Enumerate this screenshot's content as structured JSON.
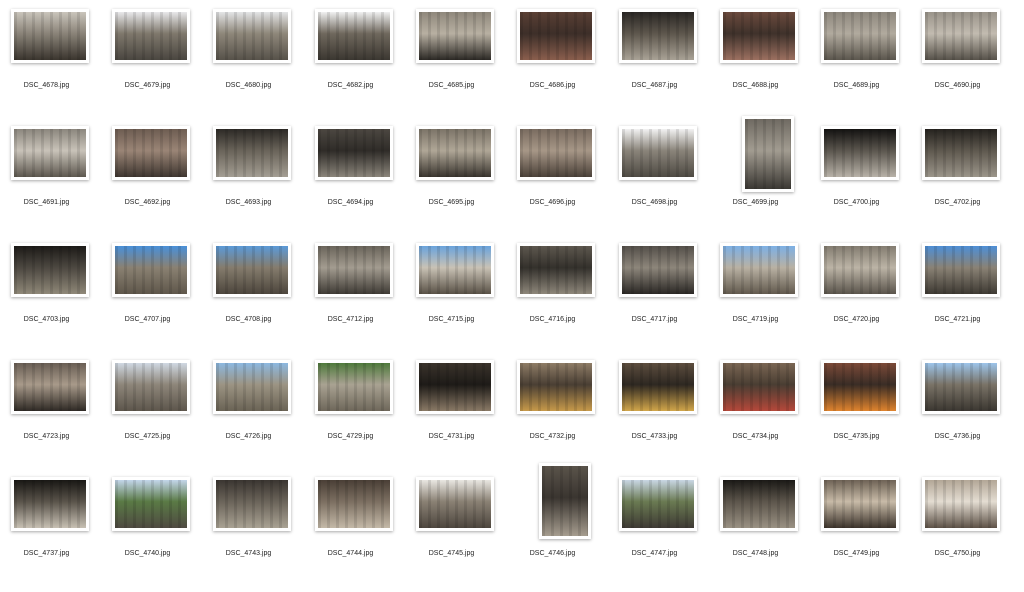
{
  "files": [
    {
      "name": "DSC_4678.jpg",
      "orientation": "landscape",
      "colors": [
        "#c9c4bb",
        "#3a352e",
        "#8a8378"
      ]
    },
    {
      "name": "DSC_4679.jpg",
      "orientation": "landscape",
      "colors": [
        "#e8e8ea",
        "#4a4640",
        "#7f786c"
      ]
    },
    {
      "name": "DSC_4680.jpg",
      "orientation": "landscape",
      "colors": [
        "#e3e4e6",
        "#57524a",
        "#8e877a"
      ]
    },
    {
      "name": "DSC_4682.jpg",
      "orientation": "landscape",
      "colors": [
        "#f0f0f0",
        "#3b3731",
        "#6f685d"
      ]
    },
    {
      "name": "DSC_4685.jpg",
      "orientation": "landscape",
      "colors": [
        "#8f887c",
        "#2c2925",
        "#b8b0a2"
      ]
    },
    {
      "name": "DSC_4686.jpg",
      "orientation": "landscape",
      "colors": [
        "#5a3f34",
        "#8a5e4d",
        "#3d2f29"
      ]
    },
    {
      "name": "DSC_4687.jpg",
      "orientation": "landscape",
      "colors": [
        "#2a2724",
        "#a9a296",
        "#5e574d"
      ]
    },
    {
      "name": "DSC_4688.jpg",
      "orientation": "landscape",
      "colors": [
        "#6b4a3d",
        "#9c7060",
        "#3f322b"
      ]
    },
    {
      "name": "DSC_4689.jpg",
      "orientation": "landscape",
      "colors": [
        "#8e887e",
        "#5b564d",
        "#b1aa9e"
      ]
    },
    {
      "name": "DSC_4690.jpg",
      "orientation": "landscape",
      "colors": [
        "#9a948a",
        "#57524a",
        "#c2bbb0"
      ]
    },
    {
      "name": "DSC_4691.jpg",
      "orientation": "landscape",
      "colors": [
        "#8c877e",
        "#5d584f",
        "#c9c3b9"
      ]
    },
    {
      "name": "DSC_4692.jpg",
      "orientation": "landscape",
      "colors": [
        "#6e5d52",
        "#3f3630",
        "#9a8576"
      ]
    },
    {
      "name": "DSC_4693.jpg",
      "orientation": "landscape",
      "colors": [
        "#2d2a26",
        "#a49e93",
        "#6a645a"
      ]
    },
    {
      "name": "DSC_4694.jpg",
      "orientation": "landscape",
      "colors": [
        "#4c4741",
        "#8b857b",
        "#2f2c28"
      ]
    },
    {
      "name": "DSC_4695.jpg",
      "orientation": "landscape",
      "colors": [
        "#7c7468",
        "#3a352f",
        "#b0a797"
      ]
    },
    {
      "name": "DSC_4696.jpg",
      "orientation": "landscape",
      "colors": [
        "#7a6c60",
        "#4b4139",
        "#a79787"
      ]
    },
    {
      "name": "DSC_4698.jpg",
      "orientation": "landscape",
      "colors": [
        "#f2f2f2",
        "#4e4a43",
        "#8a847a"
      ]
    },
    {
      "name": "DSC_4699.jpg",
      "orientation": "portrait",
      "colors": [
        "#6f6a62",
        "#3b3833",
        "#a29c91"
      ]
    },
    {
      "name": "DSC_4700.jpg",
      "orientation": "landscape",
      "colors": [
        "#141312",
        "#b8b2a8",
        "#5c574f"
      ]
    },
    {
      "name": "DSC_4702.jpg",
      "orientation": "landscape",
      "colors": [
        "#26231f",
        "#9b958a",
        "#5f594f"
      ]
    },
    {
      "name": "DSC_4703.jpg",
      "orientation": "landscape",
      "colors": [
        "#1d1b18",
        "#8f8878",
        "#4d4841"
      ]
    },
    {
      "name": "DSC_4707.jpg",
      "orientation": "landscape",
      "colors": [
        "#4a90d9",
        "#5f574b",
        "#8a8172"
      ]
    },
    {
      "name": "DSC_4708.jpg",
      "orientation": "landscape",
      "colors": [
        "#5b9ad8",
        "#4d463d",
        "#857c6d"
      ]
    },
    {
      "name": "DSC_4712.jpg",
      "orientation": "landscape",
      "colors": [
        "#6b655b",
        "#3f3b35",
        "#a39c90"
      ]
    },
    {
      "name": "DSC_4715.jpg",
      "orientation": "landscape",
      "colors": [
        "#6aa3dc",
        "#5a5247",
        "#c9c2b5"
      ]
    },
    {
      "name": "DSC_4716.jpg",
      "orientation": "landscape",
      "colors": [
        "#5d574e",
        "#8e877b",
        "#34312c"
      ]
    },
    {
      "name": "DSC_4717.jpg",
      "orientation": "landscape",
      "colors": [
        "#55504a",
        "#2b2825",
        "#8d867b"
      ]
    },
    {
      "name": "DSC_4719.jpg",
      "orientation": "landscape",
      "colors": [
        "#7db0e4",
        "#625a4e",
        "#b9b1a3"
      ]
    },
    {
      "name": "DSC_4720.jpg",
      "orientation": "landscape",
      "colors": [
        "#847d71",
        "#5b554c",
        "#bcb4a6"
      ]
    },
    {
      "name": "DSC_4721.jpg",
      "orientation": "landscape",
      "colors": [
        "#4e8fd6",
        "#3e3a33",
        "#8a8275"
      ]
    },
    {
      "name": "DSC_4723.jpg",
      "orientation": "landscape",
      "colors": [
        "#6a5f55",
        "#2f2a25",
        "#a89a8a"
      ]
    },
    {
      "name": "DSC_4725.jpg",
      "orientation": "landscape",
      "colors": [
        "#cfd8e2",
        "#5d564c",
        "#8e867a"
      ]
    },
    {
      "name": "DSC_4726.jpg",
      "orientation": "landscape",
      "colors": [
        "#8cb8e0",
        "#6a6355",
        "#9c9483"
      ]
    },
    {
      "name": "DSC_4729.jpg",
      "orientation": "landscape",
      "colors": [
        "#4f7a3c",
        "#6e675a",
        "#a9a292"
      ]
    },
    {
      "name": "DSC_4731.jpg",
      "orientation": "landscape",
      "colors": [
        "#3a332b",
        "#8a7a66",
        "#1e1b18"
      ]
    },
    {
      "name": "DSC_4732.jpg",
      "orientation": "landscape",
      "colors": [
        "#8e7c66",
        "#c79a4a",
        "#4a3f34"
      ]
    },
    {
      "name": "DSC_4733.jpg",
      "orientation": "landscape",
      "colors": [
        "#5c4d3e",
        "#d2a64a",
        "#2e2822"
      ]
    },
    {
      "name": "DSC_4734.jpg",
      "orientation": "landscape",
      "colors": [
        "#7a6653",
        "#b5483a",
        "#4a3e33"
      ]
    },
    {
      "name": "DSC_4735.jpg",
      "orientation": "landscape",
      "colors": [
        "#7b4a38",
        "#e0842e",
        "#3a2d26"
      ]
    },
    {
      "name": "DSC_4736.jpg",
      "orientation": "landscape",
      "colors": [
        "#9cc4ea",
        "#3b3731",
        "#7a7367"
      ]
    },
    {
      "name": "DSC_4737.jpg",
      "orientation": "landscape",
      "colors": [
        "#1a1815",
        "#c7c0b3",
        "#5a544b"
      ]
    },
    {
      "name": "DSC_4740.jpg",
      "orientation": "landscape",
      "colors": [
        "#c3d6ea",
        "#4f4a42",
        "#5a7a45"
      ]
    },
    {
      "name": "DSC_4743.jpg",
      "orientation": "landscape",
      "colors": [
        "#3b3631",
        "#a9a293",
        "#6b645a"
      ]
    },
    {
      "name": "DSC_4744.jpg",
      "orientation": "landscape",
      "colors": [
        "#4a3f36",
        "#c4b9a8",
        "#7c6f61"
      ]
    },
    {
      "name": "DSC_4745.jpg",
      "orientation": "landscape",
      "colors": [
        "#e9e7e2",
        "#4d463e",
        "#8a8174"
      ]
    },
    {
      "name": "DSC_4746.jpg",
      "orientation": "portrait",
      "colors": [
        "#5a534a",
        "#a69d8f",
        "#3a3530"
      ]
    },
    {
      "name": "DSC_4747.jpg",
      "orientation": "landscape",
      "colors": [
        "#c9d7e4",
        "#3e3a34",
        "#6a7a52"
      ]
    },
    {
      "name": "DSC_4748.jpg",
      "orientation": "landscape",
      "colors": [
        "#1c1a17",
        "#9a9183",
        "#5d564c"
      ]
    },
    {
      "name": "DSC_4749.jpg",
      "orientation": "landscape",
      "colors": [
        "#6f6356",
        "#3e352d",
        "#c8bba8"
      ]
    },
    {
      "name": "DSC_4750.jpg",
      "orientation": "landscape",
      "colors": [
        "#b3a797",
        "#5e5247",
        "#e4ddd2"
      ]
    }
  ]
}
